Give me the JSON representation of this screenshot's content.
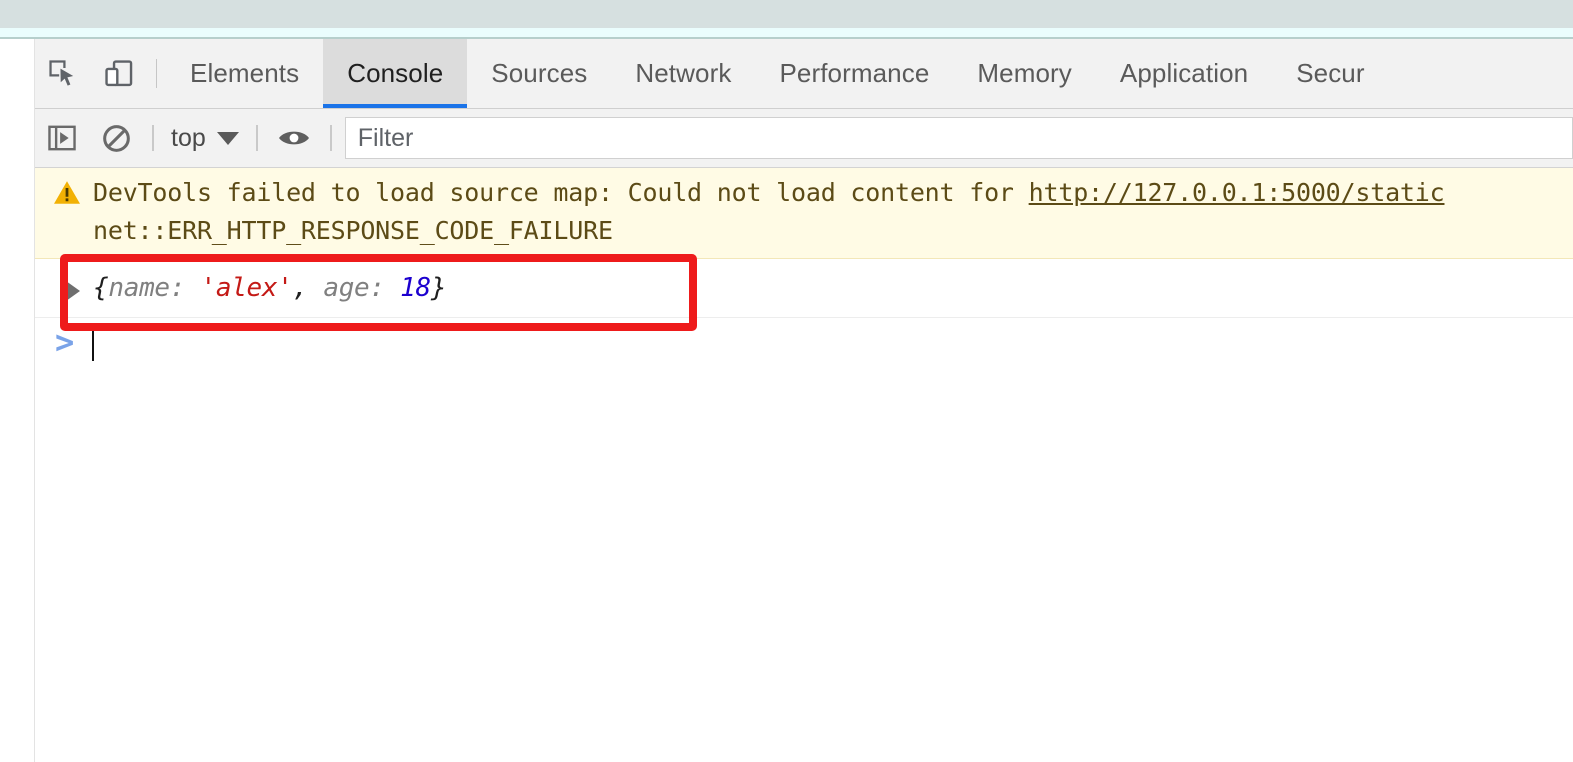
{
  "browser_chrome": {
    "top_strip_color": "#d6e0e0",
    "band_color": "#eafdfd"
  },
  "devtools": {
    "tabbar": {
      "inspect_icon": "inspect-element-icon",
      "device_toolbar_icon": "device-toolbar-icon",
      "tabs": [
        {
          "label": "Elements",
          "active": false
        },
        {
          "label": "Console",
          "active": true
        },
        {
          "label": "Sources",
          "active": false
        },
        {
          "label": "Network",
          "active": false
        },
        {
          "label": "Performance",
          "active": false
        },
        {
          "label": "Memory",
          "active": false
        },
        {
          "label": "Application",
          "active": false
        },
        {
          "label": "Secur",
          "active": false
        }
      ],
      "active_tab_underline_color": "#1a73e8",
      "active_tab_background": "#dcdcdc"
    },
    "filterbar": {
      "sidebar_toggle_icon": "console-sidebar-toggle-icon",
      "clear_console_icon": "clear-console-icon",
      "context_value": "top",
      "dropdown_icon": "chevron-down-icon",
      "eye_icon": "live-expression-eye-icon",
      "filter_placeholder": "Filter",
      "filter_value": ""
    },
    "console": {
      "warning": {
        "icon": "warning-triangle-icon",
        "line1_before_link": "DevTools failed to load source map: Could not load content for ",
        "link_text": "http://127.0.0.1:5000/static",
        "line2": "net::ERR_HTTP_RESPONSE_CODE_FAILURE",
        "background_color": "#fffbe5",
        "text_color": "#5c4b16"
      },
      "object_result": {
        "expand_icon": "disclosure-triangle-icon",
        "open_brace": "{",
        "key1": "name:",
        "value1": "'alex'",
        "separator": ", ",
        "key2": "age:",
        "value2": "18",
        "close_brace": "}",
        "string_color": "#c41a16",
        "number_color": "#1c00cf",
        "key_color": "#808080"
      },
      "prompt": {
        "chevron": ">",
        "input_value": "",
        "chevron_color": "#7aa3e8"
      }
    },
    "annotation": {
      "box_color": "#ee1b1b",
      "label": "highlighted-console-object"
    }
  }
}
